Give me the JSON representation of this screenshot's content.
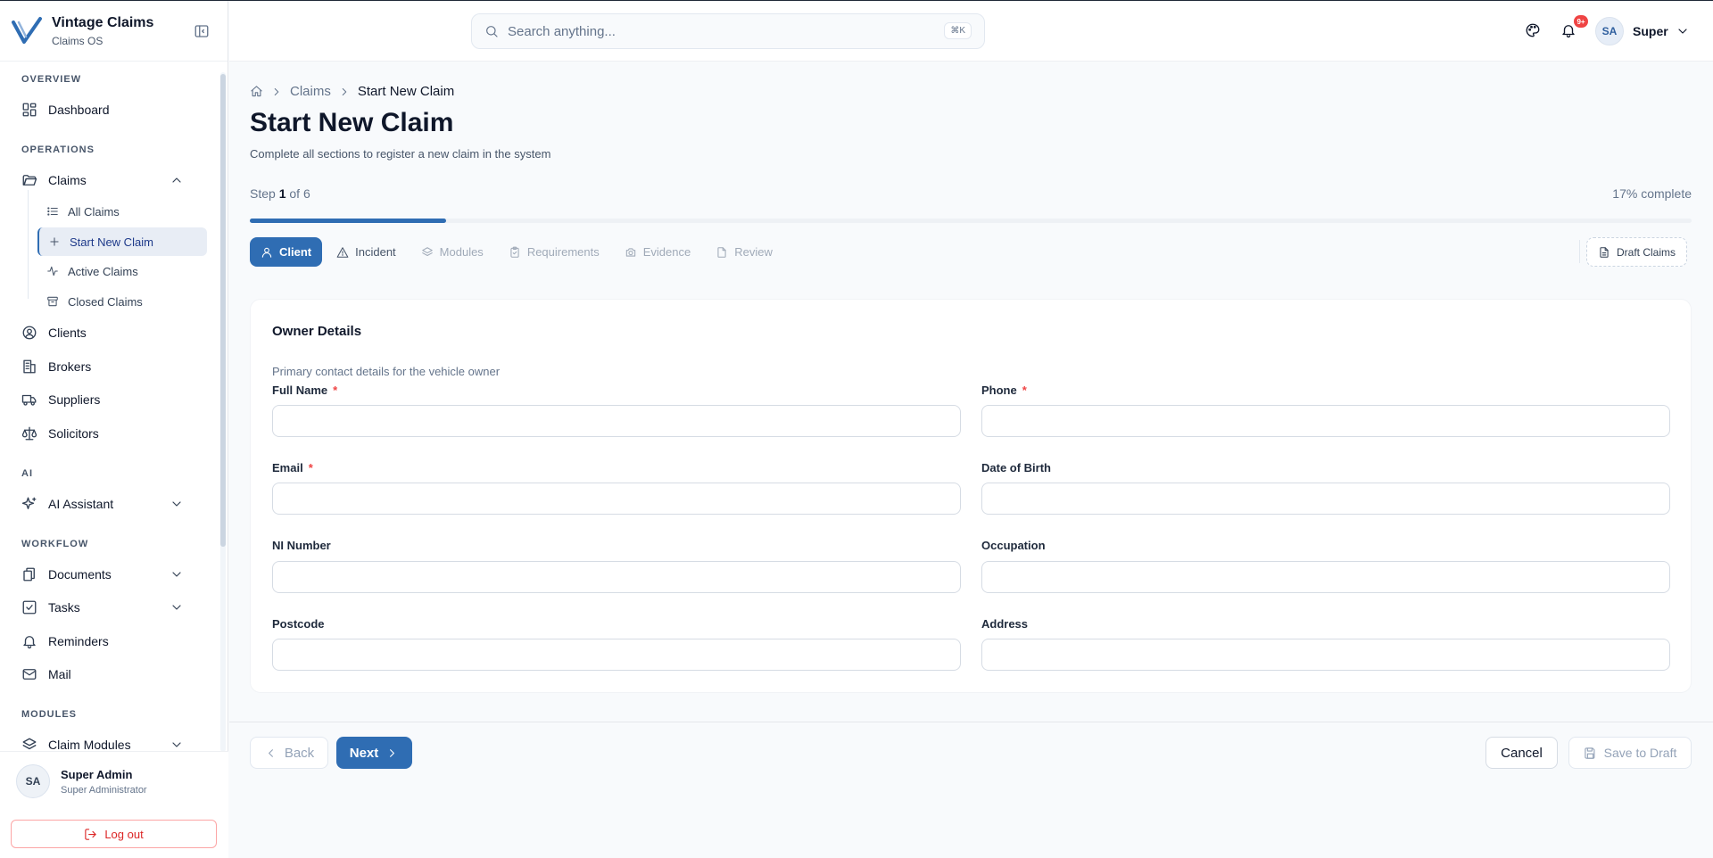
{
  "brand": {
    "name": "Vintage Claims",
    "subtitle": "Claims OS"
  },
  "search": {
    "placeholder": "Search anything...",
    "shortcut": "⌘K"
  },
  "topbar": {
    "notification_count": "9+",
    "user_initials": "SA",
    "user_name": "Super"
  },
  "sidebar": {
    "sections": {
      "overview": "OVERVIEW",
      "operations": "OPERATIONS",
      "ai": "AI",
      "workflow": "WORKFLOW",
      "modules": "MODULES"
    },
    "items": {
      "dashboard": "Dashboard",
      "claims": "Claims",
      "all_claims": "All Claims",
      "start_new_claim": "Start New Claim",
      "active_claims": "Active Claims",
      "closed_claims": "Closed Claims",
      "clients": "Clients",
      "brokers": "Brokers",
      "suppliers": "Suppliers",
      "solicitors": "Solicitors",
      "ai_assistant": "AI Assistant",
      "documents": "Documents",
      "tasks": "Tasks",
      "reminders": "Reminders",
      "mail": "Mail",
      "claim_modules": "Claim Modules"
    },
    "footer": {
      "initials": "SA",
      "name": "Super Admin",
      "role": "Super Administrator",
      "logout": "Log out"
    }
  },
  "breadcrumb": {
    "claims": "Claims",
    "current": "Start New Claim"
  },
  "page": {
    "title": "Start New Claim",
    "subtitle": "Complete all sections to register a new claim in the system"
  },
  "progress": {
    "step_prefix": "Step",
    "current_step": "1",
    "step_suffix": "of 6",
    "percent_label": "17% complete",
    "fraction": 0.17
  },
  "tabs": {
    "client": "Client",
    "incident": "Incident",
    "modules": "Modules",
    "requirements": "Requirements",
    "evidence": "Evidence",
    "review": "Review",
    "draft_claims": "Draft Claims"
  },
  "form": {
    "title": "Owner Details",
    "subtitle": "Primary contact details for the vehicle owner",
    "required_mark": "*",
    "fields": {
      "full_name": {
        "label": "Full Name",
        "value": ""
      },
      "phone": {
        "label": "Phone",
        "value": ""
      },
      "email": {
        "label": "Email",
        "value": ""
      },
      "dob": {
        "label": "Date of Birth",
        "value": ""
      },
      "ni_number": {
        "label": "NI Number",
        "value": ""
      },
      "occupation": {
        "label": "Occupation",
        "value": ""
      },
      "postcode": {
        "label": "Postcode",
        "value": ""
      },
      "address": {
        "label": "Address",
        "value": ""
      }
    }
  },
  "actions": {
    "back": "Back",
    "next": "Next",
    "cancel": "Cancel",
    "save_draft": "Save to Draft"
  },
  "colors": {
    "primary": "#2f6db3",
    "danger": "#ef4444"
  }
}
